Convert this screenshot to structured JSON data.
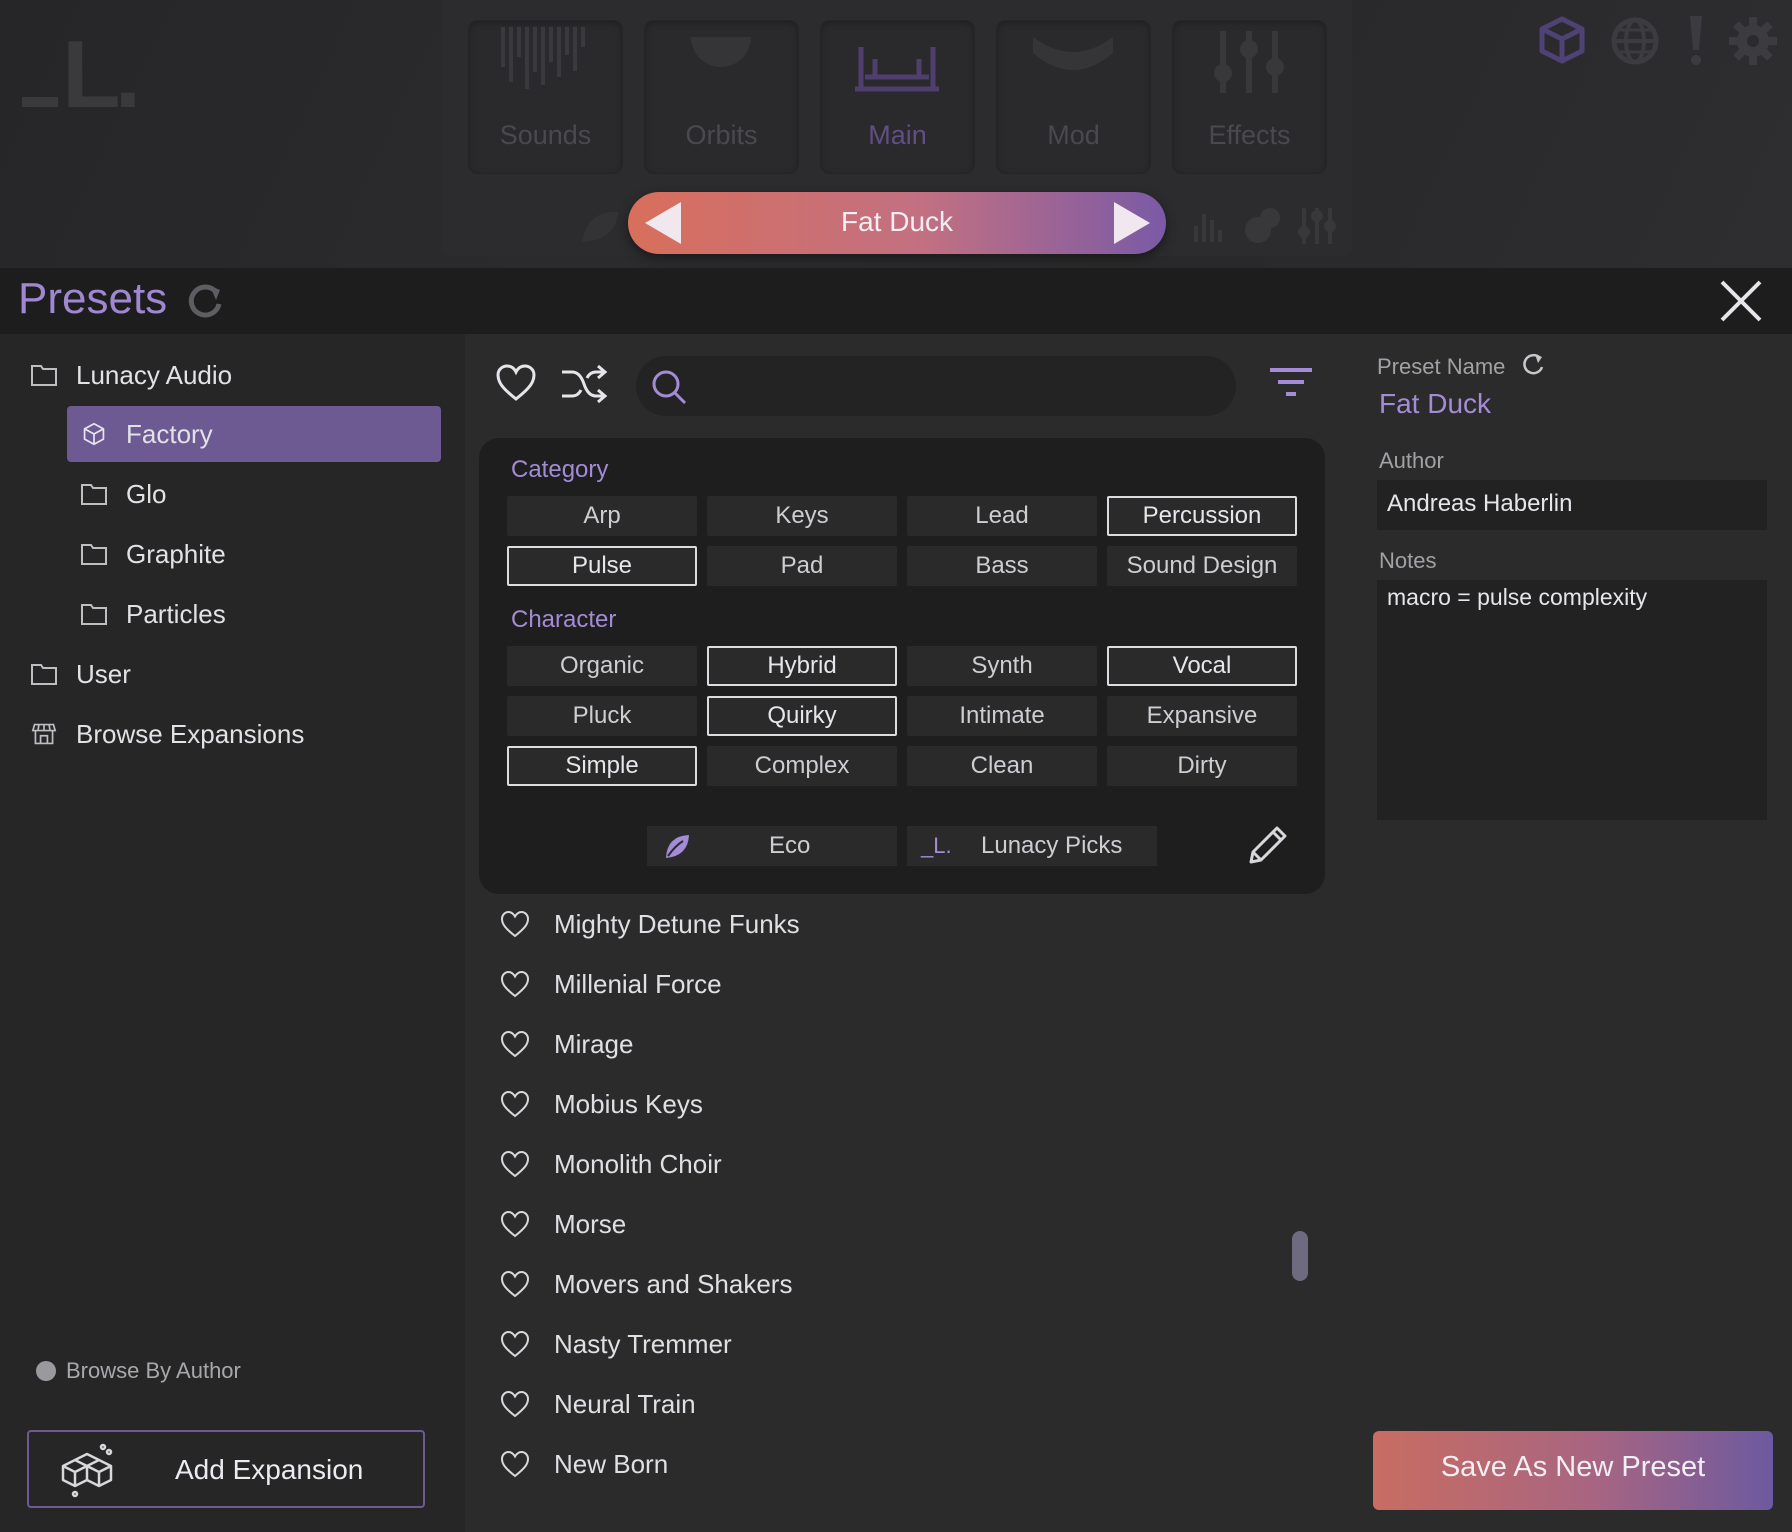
{
  "top": {
    "logo": "_L.",
    "nav_tabs": [
      {
        "label": "Sounds",
        "icon": "sound-bars-icon"
      },
      {
        "label": "Orbits",
        "icon": "orbit-icon"
      },
      {
        "label": "Main",
        "icon": "main-icon",
        "active": true
      },
      {
        "label": "Mod",
        "icon": "mod-icon"
      },
      {
        "label": "Effects",
        "icon": "effects-icon"
      }
    ],
    "current_preset": "Fat Duck",
    "icons": [
      "cube-icon",
      "globe-icon",
      "alert-icon",
      "gear-icon"
    ]
  },
  "header": {
    "title": "Presets"
  },
  "sidebar": {
    "items": [
      {
        "label": "Lunacy Audio"
      },
      {
        "label": "Factory"
      },
      {
        "label": "Glo"
      },
      {
        "label": "Graphite"
      },
      {
        "label": "Particles"
      },
      {
        "label": "User"
      },
      {
        "label": "Browse Expansions"
      }
    ],
    "browse_by_author": "Browse By Author",
    "add_expansion": "Add Expansion"
  },
  "filters": {
    "category_title": "Category",
    "category": [
      {
        "label": "Arp",
        "selected": false
      },
      {
        "label": "Keys",
        "selected": false
      },
      {
        "label": "Lead",
        "selected": false
      },
      {
        "label": "Percussion",
        "selected": true
      },
      {
        "label": "Pulse",
        "selected": true
      },
      {
        "label": "Pad",
        "selected": false
      },
      {
        "label": "Bass",
        "selected": false
      },
      {
        "label": "Sound Design",
        "selected": false
      }
    ],
    "character_title": "Character",
    "character": [
      {
        "label": "Organic",
        "selected": false
      },
      {
        "label": "Hybrid",
        "selected": true
      },
      {
        "label": "Synth",
        "selected": false
      },
      {
        "label": "Vocal",
        "selected": true
      },
      {
        "label": "Pluck",
        "selected": false
      },
      {
        "label": "Quirky",
        "selected": true
      },
      {
        "label": "Intimate",
        "selected": false
      },
      {
        "label": "Expansive",
        "selected": false
      },
      {
        "label": "Simple",
        "selected": true
      },
      {
        "label": "Complex",
        "selected": false
      },
      {
        "label": "Clean",
        "selected": false
      },
      {
        "label": "Dirty",
        "selected": false
      }
    ],
    "eco": "Eco",
    "lunacy_picks_logo": "_L.",
    "lunacy_picks": "Lunacy Picks"
  },
  "presets": [
    "Mighty Detune Funks",
    "Millenial Force",
    "Mirage",
    "Mobius Keys",
    "Monolith Choir",
    "Morse",
    "Movers and Shakers",
    "Nasty Tremmer",
    "Neural Train",
    "New Born"
  ],
  "details": {
    "preset_name_label": "Preset Name",
    "preset_name": "Fat Duck",
    "author_label": "Author",
    "author": "Andreas Haberlin",
    "notes_label": "Notes",
    "notes": "macro = pulse complexity",
    "save_button": "Save As New Preset"
  },
  "colors": {
    "accent": "#9f87d2",
    "selected_bg": "#6e5a93",
    "gradient_start": "#d86f5c",
    "gradient_end": "#7a5aa6"
  }
}
